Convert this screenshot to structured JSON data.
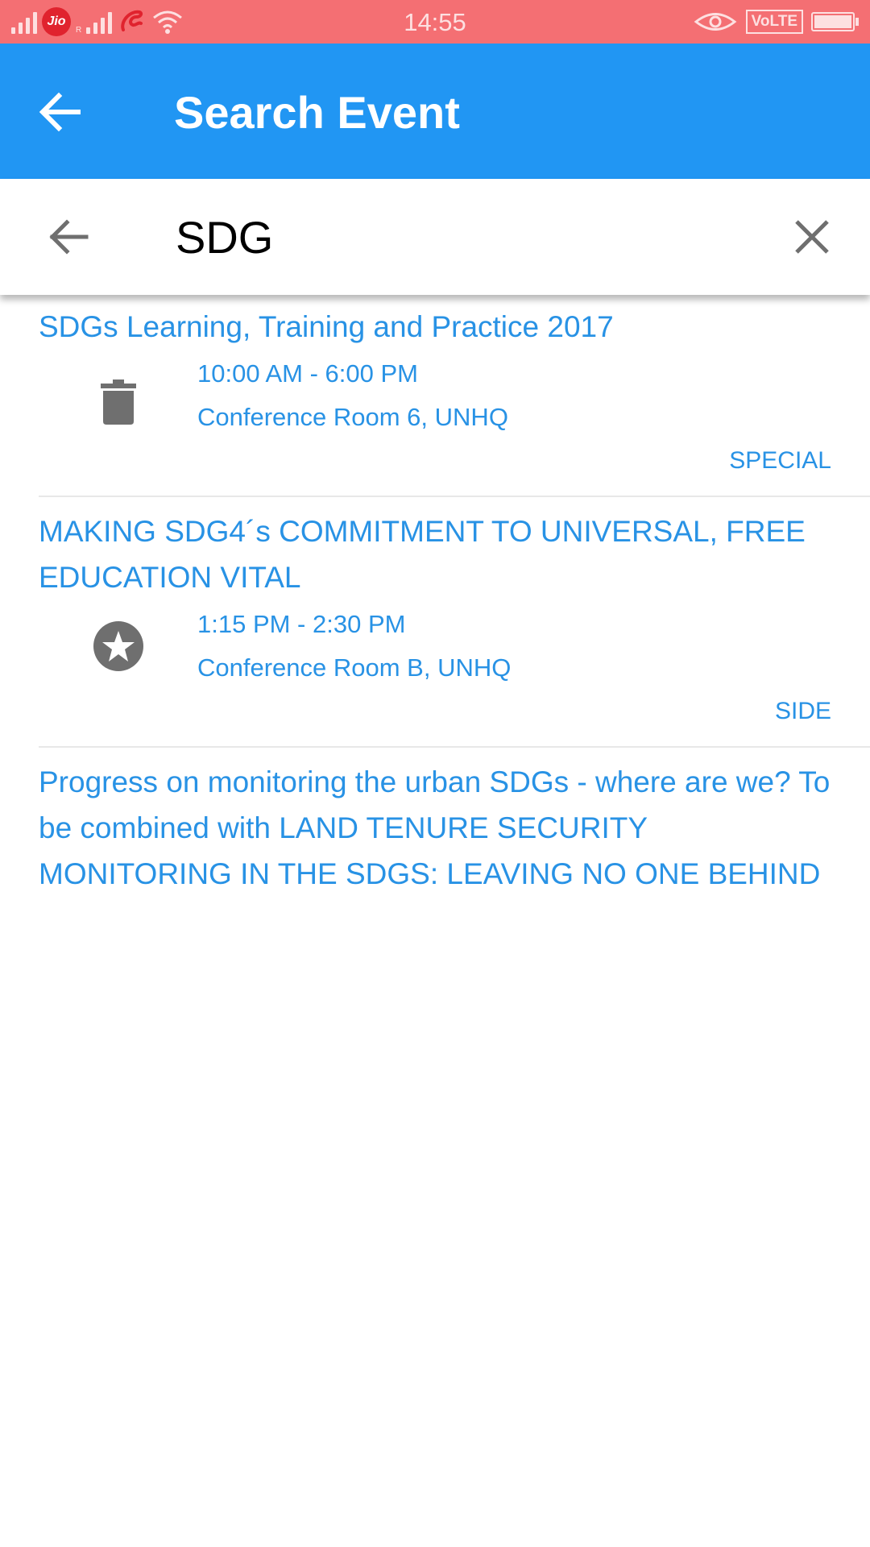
{
  "status_bar": {
    "time": "14:55",
    "carrier_badge": "Jio",
    "sim_indicator": "R",
    "volte_label": "VoLTE"
  },
  "app_bar": {
    "title": "Search Event",
    "back_icon": "arrow-left-icon"
  },
  "search": {
    "query": "SDG",
    "back_icon": "arrow-left-icon",
    "clear_icon": "close-icon"
  },
  "results": [
    {
      "title": "SDGs Learning, Training and Practice 2017",
      "time": "10:00 AM - 6:00 PM",
      "location": "Conference Room 6, UNHQ",
      "type": "SPECIAL",
      "icon": "trash-icon"
    },
    {
      "title": "MAKING SDG4´s COMMITMENT TO UNIVERSAL, FREE EDUCATION VITAL",
      "time": "1:15 PM - 2:30 PM",
      "location": "Conference Room B, UNHQ",
      "type": "SIDE",
      "icon": "star-icon"
    },
    {
      "title": "Progress on monitoring the urban SDGs - where are we? To be combined with LAND TENURE SECURITY MONITORING IN THE SDGS: LEAVING NO ONE BEHIND"
    }
  ],
  "colors": {
    "status_bar": "#f46f73",
    "app_bar": "#2196f3",
    "link_text": "#2892e5",
    "icon_gray": "#6f6f6f"
  }
}
